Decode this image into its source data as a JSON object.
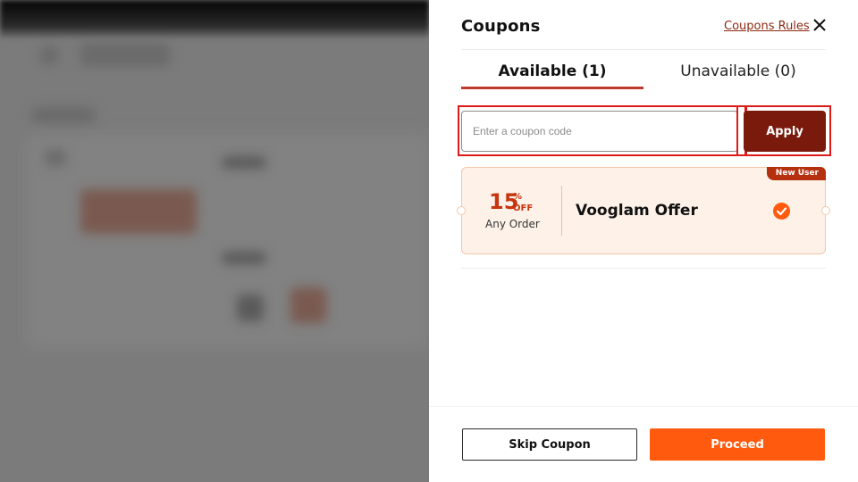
{
  "drawer": {
    "title": "Coupons",
    "rules_link": "Coupons Rules",
    "close_icon": "close-icon"
  },
  "tabs": [
    {
      "label": "Available (1)",
      "active": true
    },
    {
      "label": "Unavailable (0)",
      "active": false
    }
  ],
  "coupon_code": {
    "placeholder": "Enter a coupon code",
    "value": "",
    "apply_label": "Apply"
  },
  "coupons": [
    {
      "badge": "New User",
      "discount_number": "15",
      "discount_percent": "%",
      "discount_off": "OFF",
      "condition": "Any Order",
      "name": "Vooglam Offer",
      "selected": true,
      "icon": "check-circle-icon"
    }
  ],
  "footer": {
    "skip_label": "Skip Coupon",
    "proceed_label": "Proceed"
  },
  "colors": {
    "accent": "#ff5a0e",
    "apply_bg": "#7a1a0c",
    "link": "#8b2a12",
    "discount": "#c7350f",
    "card_bg": "#fdf1e8",
    "highlight_box": "#e01919"
  }
}
